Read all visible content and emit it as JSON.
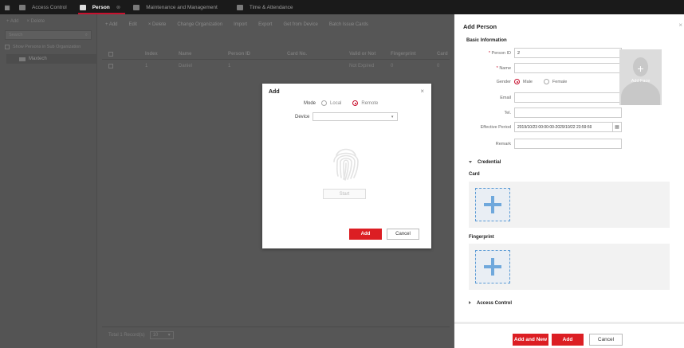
{
  "topbar": {
    "tabs": [
      {
        "label": "Access Control"
      },
      {
        "label": "Person"
      },
      {
        "label": "Maintenance and Management"
      },
      {
        "label": "Time & Attendance"
      }
    ],
    "close_glyph": "⊗"
  },
  "sidebar": {
    "add_label": "+ Add",
    "delete_label": "× Delete",
    "search_placeholder": "Search",
    "show_sub_label": "Show Persons in Sub Organization",
    "org_name": "Maxtech"
  },
  "main": {
    "toolbar": [
      "+ Add",
      "Edit",
      "× Delete",
      "Change Organization",
      "Import",
      "Export",
      "Get from Device",
      "Batch Issue Cards"
    ],
    "columns": [
      "Index",
      "Name",
      "Person ID",
      "Card No.",
      "Valid or Not",
      "Fingerprint",
      "Card"
    ],
    "rows": [
      {
        "index": "1",
        "name": "Daniel",
        "person_id": "1",
        "card_no": "",
        "valid": "Not Expired",
        "fingerprint": "0",
        "card": "0"
      }
    ],
    "footer": {
      "total_label": "Total 1 Record(s)",
      "page_size": "10"
    }
  },
  "dialog": {
    "title": "Add",
    "mode_label": "Mode",
    "mode_local": "Local",
    "mode_remote": "Remote",
    "device_label": "Device",
    "device_value": "",
    "start_label": "Start",
    "add_label": "Add",
    "cancel_label": "Cancel"
  },
  "panel": {
    "title": "Add Person",
    "basic_info": "Basic Information",
    "person_id_label": "Person ID",
    "person_id_value": "2",
    "name_label": "Name",
    "name_value": "",
    "gender_label": "Gender",
    "gender_male": "Male",
    "gender_female": "Female",
    "email_label": "Email",
    "tel_label": "Tel.",
    "effective_label": "Effective Period",
    "effective_value": "2019/10/23 00:00:00-2029/10/22 23:59:59",
    "remark_label": "Remark",
    "add_face": "Add Face",
    "credential": "Credential",
    "card": "Card",
    "fingerprint": "Fingerprint",
    "access_control": "Access Control",
    "btn_add_new": "Add and New",
    "btn_add": "Add",
    "btn_cancel": "Cancel"
  },
  "colors": {
    "accent": "#dc1e23",
    "tile_border": "#5b9bd5"
  }
}
